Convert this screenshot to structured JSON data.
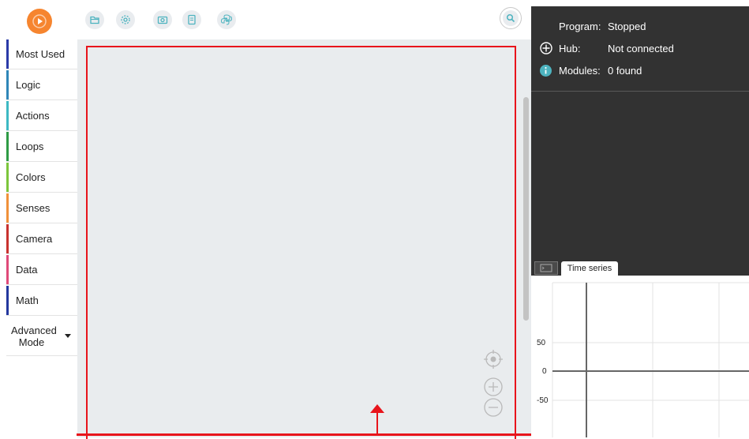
{
  "app": {
    "logo_icon": "play-icon",
    "brand_color": "#f6852f"
  },
  "toolbar": {
    "buttons": [
      {
        "icon": "folder-icon",
        "name": "folder-button"
      },
      {
        "icon": "gear-icon",
        "name": "settings-button"
      },
      {
        "icon": "camera-icon",
        "name": "camera-button"
      },
      {
        "icon": "document-icon",
        "name": "document-button"
      },
      {
        "icon": "python-icon",
        "name": "python-button"
      }
    ],
    "search_icon": "search-icon"
  },
  "sidebar": {
    "categories": [
      {
        "label": "Most Used",
        "color": "#2a3aa8"
      },
      {
        "label": "Logic",
        "color": "#2f86b8"
      },
      {
        "label": "Actions",
        "color": "#3db9c3"
      },
      {
        "label": "Loops",
        "color": "#2e9b45"
      },
      {
        "label": "Colors",
        "color": "#7cc63c"
      },
      {
        "label": "Senses",
        "color": "#f0913a"
      },
      {
        "label": "Camera",
        "color": "#c8322f"
      },
      {
        "label": "Data",
        "color": "#e04a79"
      },
      {
        "label": "Math",
        "color": "#23389e"
      }
    ],
    "advanced": {
      "label": "Advanced Mode"
    }
  },
  "status": {
    "program_label": "Program:",
    "program_value": "Stopped",
    "hub_label": "Hub:",
    "hub_value": "Not connected",
    "modules_label": "Modules:",
    "modules_value": "0 found"
  },
  "tabs": {
    "console_icon": "terminal-icon",
    "time_series": "Time series"
  },
  "chart": {
    "yticks": [
      "50",
      "0",
      "-50"
    ]
  },
  "colors": {
    "annotation": "#e8141b",
    "panel_dark": "#323232"
  }
}
